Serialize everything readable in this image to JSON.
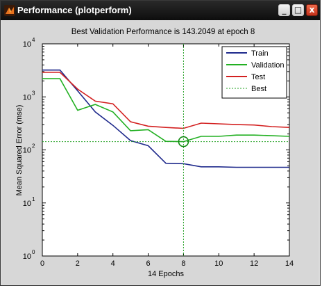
{
  "window": {
    "title": "Performance (plotperform)",
    "buttons": {
      "minimize": "_",
      "maximize": "□",
      "close": "x"
    }
  },
  "chart_data": {
    "type": "line",
    "title": "Best Validation Performance is 143.2049 at epoch 8",
    "xlabel": "14 Epochs",
    "ylabel": "Mean Squared Error  (mse)",
    "xlim": [
      0,
      14
    ],
    "ylim": [
      1,
      10000
    ],
    "yscale": "log",
    "xticks": [
      "0",
      "2",
      "4",
      "6",
      "8",
      "10",
      "12",
      "14"
    ],
    "yticks": [
      {
        "base": "10",
        "exp": "0",
        "value": 1
      },
      {
        "base": "10",
        "exp": "1",
        "value": 10
      },
      {
        "base": "10",
        "exp": "2",
        "value": 100
      },
      {
        "base": "10",
        "exp": "3",
        "value": 1000
      },
      {
        "base": "10",
        "exp": "4",
        "value": 10000
      }
    ],
    "x": [
      0,
      1,
      2,
      3,
      4,
      5,
      6,
      7,
      8,
      9,
      10,
      11,
      12,
      13,
      14
    ],
    "series": [
      {
        "name": "Train",
        "color": "#1f2a8c",
        "values": [
          3200,
          3200,
          1300,
          520,
          290,
          150,
          120,
          56,
          55,
          48,
          48,
          47,
          47,
          47,
          47
        ]
      },
      {
        "name": "Validation",
        "color": "#22b022",
        "values": [
          2200,
          2200,
          560,
          720,
          520,
          230,
          240,
          145,
          143.2049,
          180,
          180,
          190,
          190,
          185,
          180
        ]
      },
      {
        "name": "Test",
        "color": "#d32020",
        "values": [
          2900,
          2900,
          1400,
          830,
          740,
          340,
          280,
          265,
          255,
          320,
          310,
          300,
          295,
          275,
          265
        ]
      }
    ],
    "best": {
      "name": "Best",
      "epoch": 8,
      "value": 143.2049,
      "color": "#22a022"
    },
    "legend_position": "top-right",
    "grid": false
  }
}
